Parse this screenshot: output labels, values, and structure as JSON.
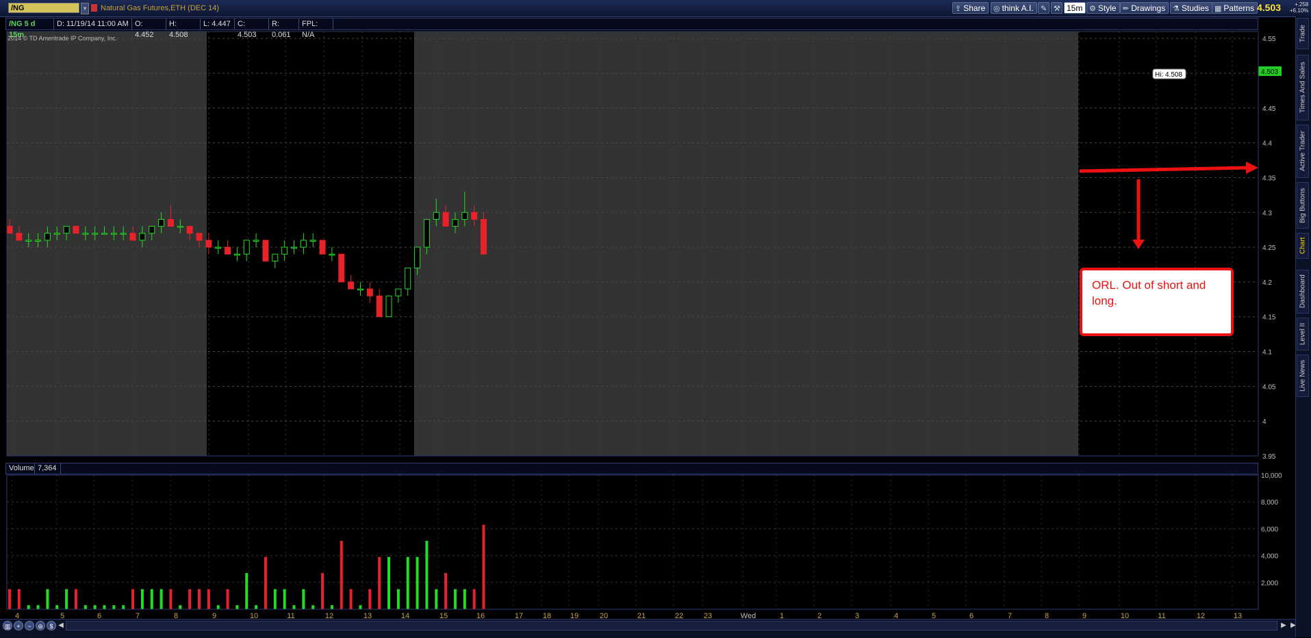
{
  "toolbar": {
    "symbol": "/NG",
    "description": "Natural Gas Futures,ETH (DEC 14)",
    "share": "Share",
    "think_ai": "think A.I.",
    "interval": "15m",
    "style": "Style",
    "drawings": "Drawings",
    "studies": "Studies",
    "patterns": "Patterns",
    "last_price": "4.503",
    "change_abs": "+.258",
    "change_pct": "+6.10%"
  },
  "info_bar": {
    "label": "/NG 5 d 15m",
    "date": "D: 11/19/14 11:00 AM",
    "open": "O: 4.452",
    "high": "H: 4.508",
    "low": "L: 4.447",
    "close": "C: 4.503",
    "range": "R: 0.061",
    "fpl": "FPL: N/A"
  },
  "copyright": "2014 © TD Ameritrade IP Company, Inc.",
  "volume_bar": {
    "label": "Volume",
    "value": "7,364"
  },
  "right_rail": [
    "Trade",
    "Times And Sales",
    "Active Trader",
    "Big Buttons",
    "Chart",
    "Dashboard",
    "Level II",
    "Live News"
  ],
  "callout": {
    "text": "ORL. Out of short and long."
  },
  "colors": {
    "up": "#22dd22",
    "down": "#e8222a",
    "background": "#000000",
    "shade": "#333333",
    "annotation": "#ee1111",
    "last_price": "#22cc22"
  },
  "chart_data": [
    {
      "type": "candlestick",
      "y_ticks": [
        "4.55",
        "4.5",
        "4.45",
        "4.4",
        "4.35",
        "4.3",
        "4.25",
        "4.2",
        "4.15",
        "4.1",
        "4.05",
        "4",
        "3.95"
      ],
      "ylim": [
        3.95,
        4.56
      ],
      "x_ticks": [
        "4",
        "5",
        "6",
        "7",
        "8",
        "9",
        "10",
        "11",
        "12",
        "13",
        "14",
        "15",
        "16",
        "17",
        "18",
        "19",
        "20",
        "21",
        "22",
        "23",
        "Wed",
        "1",
        "2",
        "3",
        "4",
        "5",
        "6",
        "7",
        "8",
        "9",
        "10",
        "11",
        "12",
        "13"
      ],
      "hi_marker": "Hi: 4.508",
      "last_price_label": "4.503",
      "ohlc": [
        [
          4.28,
          4.29,
          4.27,
          4.27
        ],
        [
          4.27,
          4.28,
          4.26,
          4.26
        ],
        [
          4.26,
          4.27,
          4.25,
          4.26
        ],
        [
          4.26,
          4.27,
          4.25,
          4.26
        ],
        [
          4.26,
          4.28,
          4.25,
          4.27
        ],
        [
          4.27,
          4.28,
          4.26,
          4.27
        ],
        [
          4.27,
          4.28,
          4.26,
          4.28
        ],
        [
          4.28,
          4.28,
          4.27,
          4.27
        ],
        [
          4.27,
          4.28,
          4.26,
          4.27
        ],
        [
          4.27,
          4.28,
          4.26,
          4.27
        ],
        [
          4.27,
          4.28,
          4.27,
          4.27
        ],
        [
          4.27,
          4.28,
          4.26,
          4.27
        ],
        [
          4.27,
          4.28,
          4.26,
          4.27
        ],
        [
          4.27,
          4.28,
          4.26,
          4.26
        ],
        [
          4.26,
          4.28,
          4.25,
          4.27
        ],
        [
          4.27,
          4.28,
          4.26,
          4.28
        ],
        [
          4.28,
          4.3,
          4.27,
          4.29
        ],
        [
          4.29,
          4.31,
          4.28,
          4.28
        ],
        [
          4.28,
          4.29,
          4.27,
          4.28
        ],
        [
          4.28,
          4.28,
          4.26,
          4.27
        ],
        [
          4.27,
          4.27,
          4.25,
          4.26
        ],
        [
          4.26,
          4.27,
          4.24,
          4.25
        ],
        [
          4.25,
          4.26,
          4.24,
          4.25
        ],
        [
          4.25,
          4.26,
          4.24,
          4.24
        ],
        [
          4.24,
          4.25,
          4.23,
          4.24
        ],
        [
          4.24,
          4.26,
          4.23,
          4.26
        ],
        [
          4.26,
          4.27,
          4.25,
          4.26
        ],
        [
          4.26,
          4.26,
          4.23,
          4.23
        ],
        [
          4.23,
          4.24,
          4.22,
          4.24
        ],
        [
          4.24,
          4.26,
          4.23,
          4.25
        ],
        [
          4.25,
          4.26,
          4.24,
          4.25
        ],
        [
          4.25,
          4.27,
          4.24,
          4.26
        ],
        [
          4.26,
          4.27,
          4.25,
          4.26
        ],
        [
          4.26,
          4.26,
          4.24,
          4.24
        ],
        [
          4.24,
          4.25,
          4.23,
          4.24
        ],
        [
          4.24,
          4.24,
          4.2,
          4.2
        ],
        [
          4.2,
          4.21,
          4.19,
          4.19
        ],
        [
          4.19,
          4.2,
          4.18,
          4.19
        ],
        [
          4.19,
          4.2,
          4.17,
          4.18
        ],
        [
          4.18,
          4.19,
          4.15,
          4.15
        ],
        [
          4.15,
          4.18,
          4.15,
          4.18
        ],
        [
          4.18,
          4.19,
          4.17,
          4.19
        ],
        [
          4.19,
          4.22,
          4.18,
          4.22
        ],
        [
          4.22,
          4.25,
          4.21,
          4.25
        ],
        [
          4.25,
          4.29,
          4.24,
          4.29
        ],
        [
          4.29,
          4.32,
          4.28,
          4.3
        ],
        [
          4.3,
          4.31,
          4.28,
          4.28
        ],
        [
          4.28,
          4.3,
          4.27,
          4.29
        ],
        [
          4.29,
          4.33,
          4.28,
          4.3
        ],
        [
          4.3,
          4.31,
          4.28,
          4.29
        ],
        [
          4.29,
          4.3,
          4.24,
          4.24
        ]
      ]
    },
    {
      "type": "bar",
      "title": "Volume",
      "y_ticks": [
        "10,000",
        "8,000",
        "6,000",
        "4,000",
        "2,000"
      ],
      "ylim": [
        0,
        10000
      ]
    }
  ]
}
